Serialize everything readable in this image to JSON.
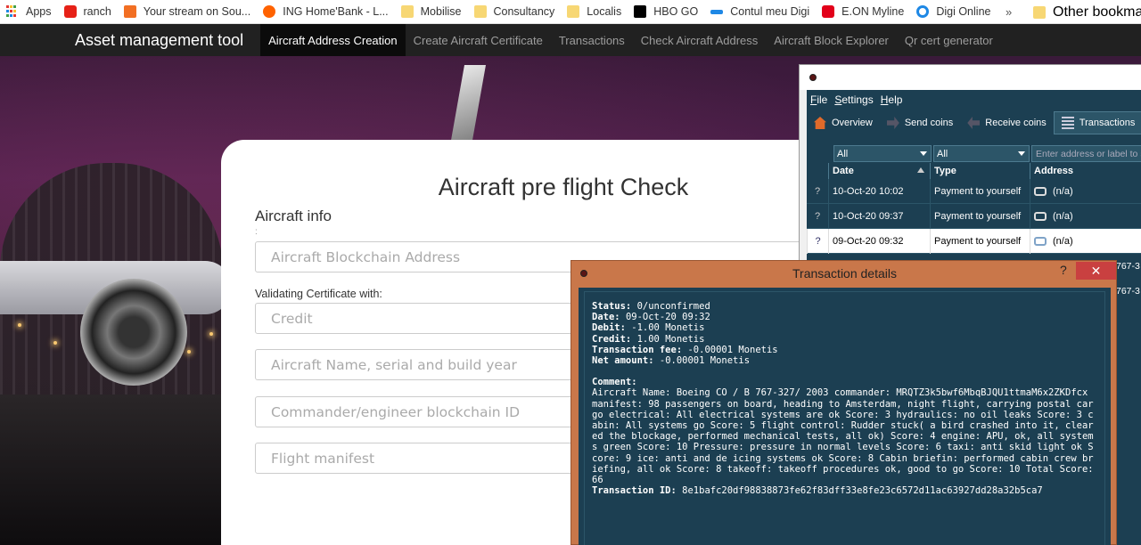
{
  "bookmarks": {
    "items": [
      {
        "label": "Apps",
        "icon": "apps-grid-icon"
      },
      {
        "label": "ranch",
        "icon": "youtube-icon",
        "color": "#e62117"
      },
      {
        "label": "Your stream on Sou...",
        "icon": "soundcloud-icon",
        "color": "#f26f23"
      },
      {
        "label": "ING Home'Bank - L...",
        "icon": "ing-lion-icon",
        "color": "#ff6200"
      },
      {
        "label": "Mobilise",
        "icon": "folder-icon"
      },
      {
        "label": "Consultancy",
        "icon": "folder-icon"
      },
      {
        "label": "Localis",
        "icon": "folder-icon"
      },
      {
        "label": "HBO GO",
        "icon": "hbo-icon",
        "color": "#000000"
      },
      {
        "label": "Contul meu Digi",
        "icon": "digi-icon",
        "color": "#1e88e5"
      },
      {
        "label": "E.ON Myline",
        "icon": "eon-icon",
        "color": "#e2001a"
      },
      {
        "label": "Digi Online",
        "icon": "digi-online-icon",
        "color": "#1e88e5"
      }
    ],
    "overflow": "»",
    "other": "Other bookmarks"
  },
  "navbar": {
    "brand": "Asset management tool",
    "links": [
      {
        "label": "Aircraft Address Creation",
        "active": true
      },
      {
        "label": "Create Aircraft Certificate",
        "active": false
      },
      {
        "label": "Transactions",
        "active": false
      },
      {
        "label": "Check Aircraft Address",
        "active": false
      },
      {
        "label": "Aircraft Block Explorer",
        "active": false
      },
      {
        "label": "Qr cert generator",
        "active": false
      }
    ]
  },
  "form": {
    "title": "Aircraft pre flight Check",
    "section": "Aircraft info",
    "colon": ":",
    "address_placeholder": "Aircraft Blockchain Address",
    "cert_label": "Validating Certificate with:",
    "credit_placeholder": "Credit",
    "name_placeholder": "Aircraft Name, serial and build year",
    "commander_placeholder": "Commander/engineer blockchain ID",
    "manifest_placeholder": "Flight manifest"
  },
  "wallet": {
    "menu": [
      "File",
      "Settings",
      "Help"
    ],
    "toolbar": [
      {
        "label": "Overview",
        "icon": "home-icon"
      },
      {
        "label": "Send coins",
        "icon": "send-arrow-icon"
      },
      {
        "label": "Receive coins",
        "icon": "receive-arrow-icon"
      },
      {
        "label": "Transactions",
        "icon": "transactions-list-icon",
        "active": true
      }
    ],
    "filter_type": "All",
    "filter_date": "All",
    "address_placeholder": "Enter address or label to search",
    "columns": [
      "Date",
      "Type",
      "Address"
    ],
    "rows": [
      {
        "status": "?",
        "date": "10-Oct-20 10:02",
        "type": "Payment to yourself",
        "address": "(n/a)",
        "selected": false
      },
      {
        "status": "?",
        "date": "10-Oct-20 09:37",
        "type": "Payment to yourself",
        "address": "(n/a)",
        "selected": false
      },
      {
        "status": "?",
        "date": "09-Oct-20 09:32",
        "type": "Payment to yourself",
        "address": "(n/a)",
        "selected": true
      }
    ],
    "truncated": [
      "767-3",
      "767-3"
    ]
  },
  "dialog": {
    "title": "Transaction details",
    "help": "?",
    "close": "✕",
    "status_label": "Status:",
    "status": "0/unconfirmed",
    "date_label": "Date:",
    "date": "09-Oct-20 09:32",
    "debit_label": "Debit:",
    "debit": "-1.00 Monetis",
    "credit_label": "Credit:",
    "credit": "1.00 Monetis",
    "fee_label": "Transaction fee:",
    "fee": "-0.00001 Monetis",
    "net_label": "Net amount:",
    "net": "-0.00001 Monetis",
    "comment_label": "Comment:",
    "comment": "Aircraft Name: Boeing CO / B 767-327/ 2003 commander: MRQTZ3k5bwf6MbqBJQU1ttmaM6x2ZKDfcx manifest: 98 passengers on board, heading to Amsterdam, night flight, carrying postal cargo electrical: All electrical systems are ok Score: 3 hydraulics: no oil leaks Score: 3 cabin: All systems go Score: 5 flight control: Rudder stuck( a bird crashed into it, cleared the blockage, performed mechanical tests, all ok) Score: 4 engine: APU, ok, all systems green Score: 10 Pressure: pressure in normal levels Score: 6 taxi: anti skid light ok Score: 9 ice: anti and de icing systems ok Score: 8 Cabin briefin: performed cabin crew briefing, all ok Score: 8 takeoff: takeoff procedures ok, good to go Score: 10 Total Score: 66",
    "txid_label": "Transaction ID:",
    "txid": "8e1bafc20df98838873fe62f83dff33e8fe23c6572d11ac63927dd28a32b5ca7"
  }
}
